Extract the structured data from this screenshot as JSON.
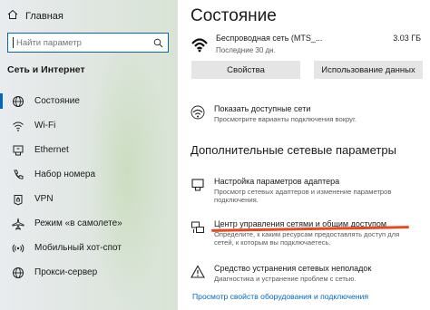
{
  "sidebar": {
    "home_label": "Главная",
    "search_placeholder": "Найти параметр",
    "section_title": "Сеть и Интернет",
    "items": [
      {
        "label": "Состояние",
        "icon": "globe-icon"
      },
      {
        "label": "Wi-Fi",
        "icon": "wifi-icon"
      },
      {
        "label": "Ethernet",
        "icon": "ethernet-icon"
      },
      {
        "label": "Набор номера",
        "icon": "dialup-icon"
      },
      {
        "label": "VPN",
        "icon": "vpn-icon"
      },
      {
        "label": "Режим «в самолете»",
        "icon": "airplane-icon"
      },
      {
        "label": "Мобильный хот-спот",
        "icon": "hotspot-icon"
      },
      {
        "label": "Прокси-сервер",
        "icon": "globe-icon"
      }
    ]
  },
  "main": {
    "title": "Состояние",
    "network": {
      "name": "Беспроводная сеть (MTS_...",
      "data_used": "3.03 ГБ",
      "period": "Последние 30 дн."
    },
    "buttons": {
      "properties": "Свойства",
      "data_usage": "Использование данных"
    },
    "show_networks": {
      "title": "Показать доступные сети",
      "desc": "Просмотрите варианты подключения вокруг."
    },
    "advanced_title": "Дополнительные сетевые параметры",
    "adapter": {
      "title": "Настройка параметров адаптера",
      "desc": "Просмотр сетевых адаптеров и изменение параметров подключения."
    },
    "sharing_center": {
      "title": "Центр управления сетями и общим доступом",
      "desc": "Определите, к каким ресурсам предоставлять доступ для сетей, к которым вы подключаетесь."
    },
    "troubleshoot": {
      "title": "Средство устранения сетевых неполадок",
      "desc": "Диагностика и устранение проблем с сетью."
    },
    "link": "Просмотр свойств оборудования и подключения"
  },
  "colors": {
    "accent": "#0067c0",
    "highlight_underline": "#e8491d",
    "button_bg": "#e5e5e5"
  }
}
